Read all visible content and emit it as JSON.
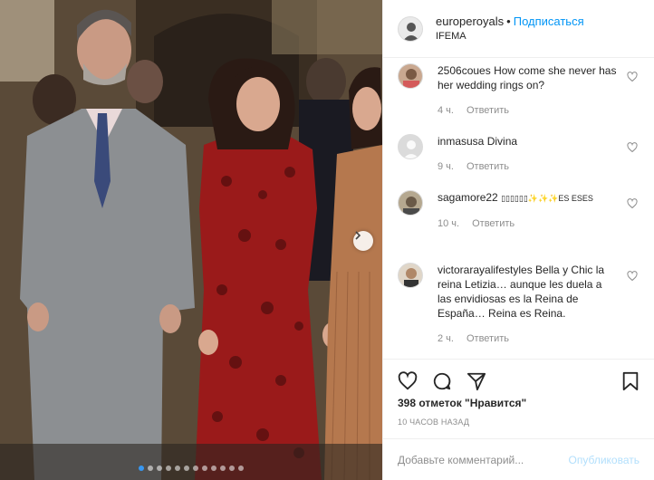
{
  "post": {
    "username": "europeroyals",
    "separator": "•",
    "follow_label": "Подписаться",
    "location": "IFEMA"
  },
  "comments": [
    {
      "user": "2506coues",
      "text": "How come she never has her wedding rings on?",
      "time": "4 ч.",
      "reply": "Ответить"
    },
    {
      "user": "inmasusa",
      "text": "Divina",
      "time": "9 ч.",
      "reply": "Ответить"
    },
    {
      "user": "sagamore22",
      "text": "▯▯▯▯▯▯✨✨✨ES ESES",
      "time": "10 ч.",
      "reply": "Ответить"
    },
    {
      "user": "victorarayalifestyles",
      "text": "Bella y Chic la reina Letizia… aunque les duela a las envidiosas es la Reina de España… Reina es Reina.",
      "time": "2 ч.",
      "reply": "Ответить"
    }
  ],
  "likes": "398 отметок \"Нравится\"",
  "timestamp": "10 ЧАСОВ НАЗАД",
  "add_comment": {
    "placeholder": "Добавьте комментарий...",
    "post_label": "Опубликовать"
  },
  "carousel": {
    "total": 12,
    "active": 1
  },
  "colors": {
    "link": "#0095f6",
    "post_disabled": "#b2dffc",
    "muted": "#8e8e8e",
    "active_dot": "#3897f0"
  },
  "icons": [
    "heart-icon",
    "comment-icon",
    "share-icon",
    "bookmark-icon",
    "chevron-right-icon"
  ]
}
